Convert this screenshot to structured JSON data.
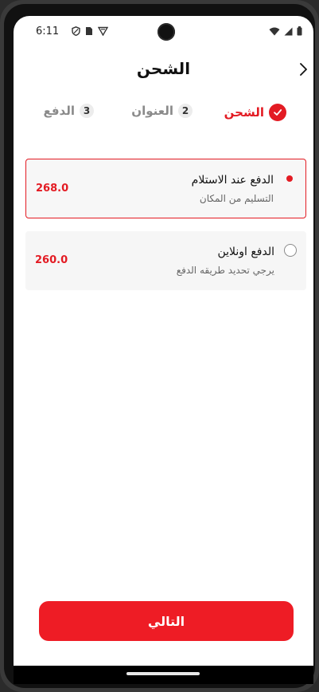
{
  "status_bar": {
    "time": "6:11",
    "left_icons": [
      "shield-icon",
      "sim-card-icon",
      "vpn-icon"
    ],
    "right_icons": [
      "wifi-icon",
      "signal-icon",
      "battery-icon"
    ]
  },
  "header": {
    "title": "الشحن"
  },
  "steps": [
    {
      "number": "",
      "label": "الشحن",
      "state": "done"
    },
    {
      "number": "2",
      "label": "العنوان",
      "state": "pending"
    },
    {
      "number": "3",
      "label": "الدفع",
      "state": "pending"
    }
  ],
  "options": [
    {
      "title": "الدفع عند الاستلام",
      "subtitle": "التسليم من المكان",
      "price": "268.0",
      "selected": true
    },
    {
      "title": "الدفع اونلاين",
      "subtitle": "يرجي تحديد طريقه الدفع",
      "price": "260.0",
      "selected": false
    }
  ],
  "next_button": {
    "label": "التالي"
  },
  "colors": {
    "accent": "#e31b23",
    "button": "#ee1c25"
  }
}
